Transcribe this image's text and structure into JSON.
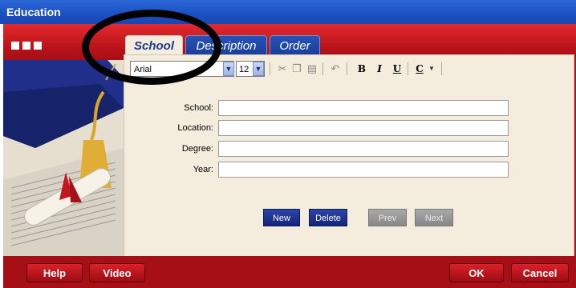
{
  "window": {
    "title": "Education"
  },
  "tabs": [
    {
      "label": "School"
    },
    {
      "label": "Description"
    },
    {
      "label": "Order"
    }
  ],
  "toolbar": {
    "font_value": "Arial",
    "size_value": "12",
    "bold_label": "B",
    "italic_label": "I",
    "underline_label": "U",
    "color_label": "C"
  },
  "form": {
    "school_label": "School:",
    "location_label": "Location:",
    "degree_label": "Degree:",
    "year_label": "Year:"
  },
  "actions": {
    "new_label": "New",
    "delete_label": "Delete",
    "prev_label": "Prev",
    "next_label": "Next"
  },
  "bottom": {
    "help_label": "Help",
    "video_label": "Video",
    "ok_label": "OK",
    "cancel_label": "Cancel"
  },
  "colors": {
    "titlebar": "#1b4fc0",
    "frame_red": "#b9111a",
    "panel": "#f4ecdc",
    "tab_blue": "#1a3e99",
    "nav_button_blue": "#14247a"
  }
}
